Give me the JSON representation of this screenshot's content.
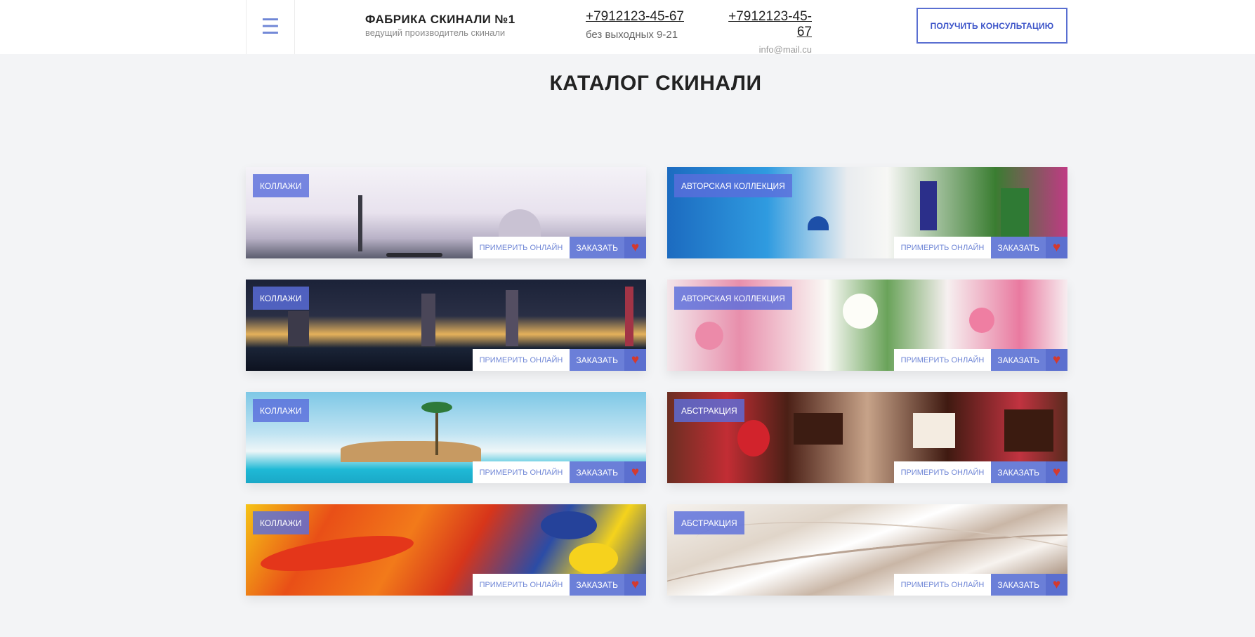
{
  "header": {
    "brand_title": "ФАБРИКА СКИНАЛИ №1",
    "brand_subtitle": "ведущий производитель скинали",
    "phone_primary": "+7912123-45-67",
    "phone_primary_note": "без выходных 9-21",
    "phone_secondary": "+7912123-45-67",
    "email": "info@mail.cu",
    "consult_button": "ПОЛУЧИТЬ КОНСУЛЬТАЦИЮ",
    "menu_icon": "hamburger-menu-icon"
  },
  "page_title": "КАТАЛОГ СКИНАЛИ",
  "cards": [
    {
      "category": "КОЛЛАЖИ",
      "image": "venice-collage"
    },
    {
      "category": "АВТОРСКАЯ КОЛЛЕКЦИЯ",
      "image": "santorini"
    },
    {
      "category": "КОЛЛАЖИ",
      "image": "new-york-skyline"
    },
    {
      "category": "АВТОРСКАЯ КОЛЛЕКЦИЯ",
      "image": "flowers"
    },
    {
      "category": "КОЛЛАЖИ",
      "image": "tropical-beach"
    },
    {
      "category": "АБСТРАКЦИЯ",
      "image": "chocolate-strawberries"
    },
    {
      "category": "КОЛЛАЖИ",
      "image": "paint-strokes"
    },
    {
      "category": "АБСТРАКЦИЯ",
      "image": "abstract-waves"
    }
  ],
  "card_actions": {
    "try_online": "ПРИМЕРИТЬ ОНЛАЙН",
    "order": "ЗАКАЗАТЬ",
    "favorite_icon": "heart-icon"
  },
  "colors": {
    "accent": "#5a6fd1",
    "heart": "#d43a2e",
    "background": "#f3f4f6"
  }
}
